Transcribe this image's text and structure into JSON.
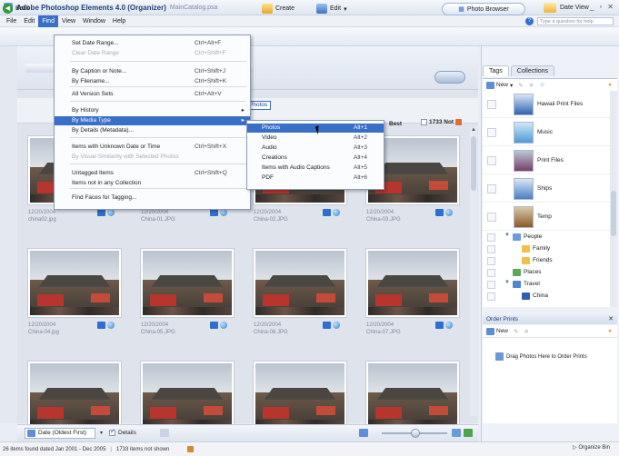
{
  "window": {
    "title": "Adobe Photoshop Elements 4.0 (Organizer)",
    "catalog": "MainCatalog.psa"
  },
  "menubar": [
    "File",
    "Edit",
    "Find",
    "View",
    "Window",
    "Help"
  ],
  "help_search": {
    "placeholder": "Type a question for help"
  },
  "toolbar": {
    "back": "Back",
    "create": "Create",
    "edit": "Edit",
    "photo_browser": "Photo Browser",
    "date_view": "Date View"
  },
  "find_menu": [
    {
      "label": "Set Date Range...",
      "shortcut": "Ctrl+Alt+F",
      "disabled": false
    },
    {
      "label": "Clear Date Range",
      "shortcut": "Ctrl+Shift+F",
      "disabled": true
    },
    {
      "label": "By Caption or Note...",
      "shortcut": "Ctrl+Shift+J",
      "disabled": false
    },
    {
      "label": "By Filename...",
      "shortcut": "Ctrl+Shift+K",
      "disabled": false
    },
    {
      "label": "All Version Sets",
      "shortcut": "Ctrl+Alt+V",
      "disabled": false
    },
    {
      "label": "By History",
      "shortcut": "",
      "disabled": false
    },
    {
      "label": "By Media Type",
      "shortcut": "",
      "disabled": false
    },
    {
      "label": "By Details (Metadata)...",
      "shortcut": "",
      "disabled": false
    },
    {
      "label": "Items with Unknown Date or Time",
      "shortcut": "Ctrl+Shift+X",
      "disabled": false
    },
    {
      "label": "By Visual Similarity with Selected Photos",
      "shortcut": "",
      "disabled": true
    },
    {
      "label": "Untagged Items",
      "shortcut": "Ctrl+Shift+Q",
      "disabled": false
    },
    {
      "label": "Items not in any Collection",
      "shortcut": "",
      "disabled": false
    },
    {
      "label": "Find Faces for Tagging...",
      "shortcut": "",
      "disabled": false
    }
  ],
  "media_submenu": [
    {
      "label": "Photos",
      "shortcut": "Alt+1"
    },
    {
      "label": "Video",
      "shortcut": "Alt+2"
    },
    {
      "label": "Audio",
      "shortcut": "Alt+3"
    },
    {
      "label": "Creations",
      "shortcut": "Alt+4"
    },
    {
      "label": "Items with Audio Captions",
      "shortcut": "Alt+5"
    },
    {
      "label": "PDF",
      "shortcut": "Alt+6"
    }
  ],
  "filter": {
    "active_tag": "Photos",
    "best": "Best",
    "not": "1733 Not"
  },
  "photos": [
    {
      "date": "12/20/2004",
      "name": "china02.jpg"
    },
    {
      "date": "12/20/2004",
      "name": "China-01.JPG"
    },
    {
      "date": "12/20/2004",
      "name": "China-02.JPG"
    },
    {
      "date": "12/20/2004",
      "name": "China-03.JPG"
    },
    {
      "date": "12/20/2004",
      "name": "China-04.jpg"
    },
    {
      "date": "12/20/2004",
      "name": "China-05.JPG"
    },
    {
      "date": "12/20/2004",
      "name": "China-06.JPG"
    },
    {
      "date": "12/20/2004",
      "name": "China-07.JPG"
    },
    {
      "date": "",
      "name": ""
    },
    {
      "date": "",
      "name": ""
    },
    {
      "date": "",
      "name": ""
    },
    {
      "date": "",
      "name": ""
    }
  ],
  "bottom": {
    "sort": "Date (Oldest First)",
    "details": "Details"
  },
  "status": {
    "found": "26 items found dated Jan 2001 - Dec 2005",
    "not_shown": "1733 items not shown",
    "organize_bin": "Organize Bin"
  },
  "tags_panel": {
    "tabs": [
      "Tags",
      "Collections"
    ],
    "new": "New",
    "image_tags": [
      "Hawaii Print Files",
      "Music",
      "Print Files",
      "Ships",
      "Temp"
    ],
    "tree": [
      {
        "label": "People",
        "level": 0,
        "expand": "▼"
      },
      {
        "label": "Family",
        "level": 1,
        "expand": ""
      },
      {
        "label": "Friends",
        "level": 1,
        "expand": ""
      },
      {
        "label": "Places",
        "level": 0,
        "expand": ""
      },
      {
        "label": "Travel",
        "level": 0,
        "expand": "▼"
      },
      {
        "label": "China",
        "level": 1,
        "expand": ""
      }
    ]
  },
  "order_prints": {
    "title": "Order Prints",
    "new": "New",
    "hint": "Drag Photos Here to Order Prints"
  },
  "colors": {
    "menu_highlight": "#3a6fc8",
    "accent": "#2f6fd1"
  }
}
